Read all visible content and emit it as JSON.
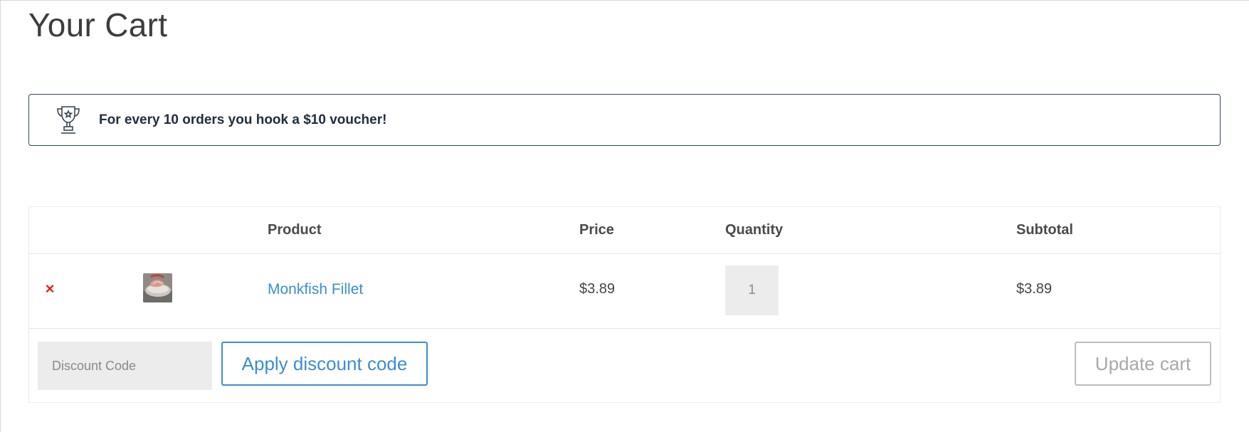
{
  "page": {
    "title": "Your Cart"
  },
  "notice": {
    "icon": "trophy-icon",
    "text": "For every 10 orders you hook a $10 voucher!"
  },
  "table": {
    "headers": {
      "thumbnail": "",
      "product": "Product",
      "price": "Price",
      "quantity": "Quantity",
      "subtotal": "Subtotal"
    },
    "items": [
      {
        "remove_icon": "close-icon",
        "remove_glyph": "×",
        "name": "Monkfish Fillet",
        "price": "$3.89",
        "quantity": "1",
        "subtotal": "$3.89"
      }
    ]
  },
  "actions": {
    "discount_placeholder": "Discount Code",
    "discount_value": "",
    "apply_label": "Apply discount code",
    "update_label": "Update cart"
  },
  "colors": {
    "accent": "#3b8ecb",
    "remove": "#e2231a",
    "notice_border": "#2f4a63",
    "input_bg": "#ececec"
  }
}
